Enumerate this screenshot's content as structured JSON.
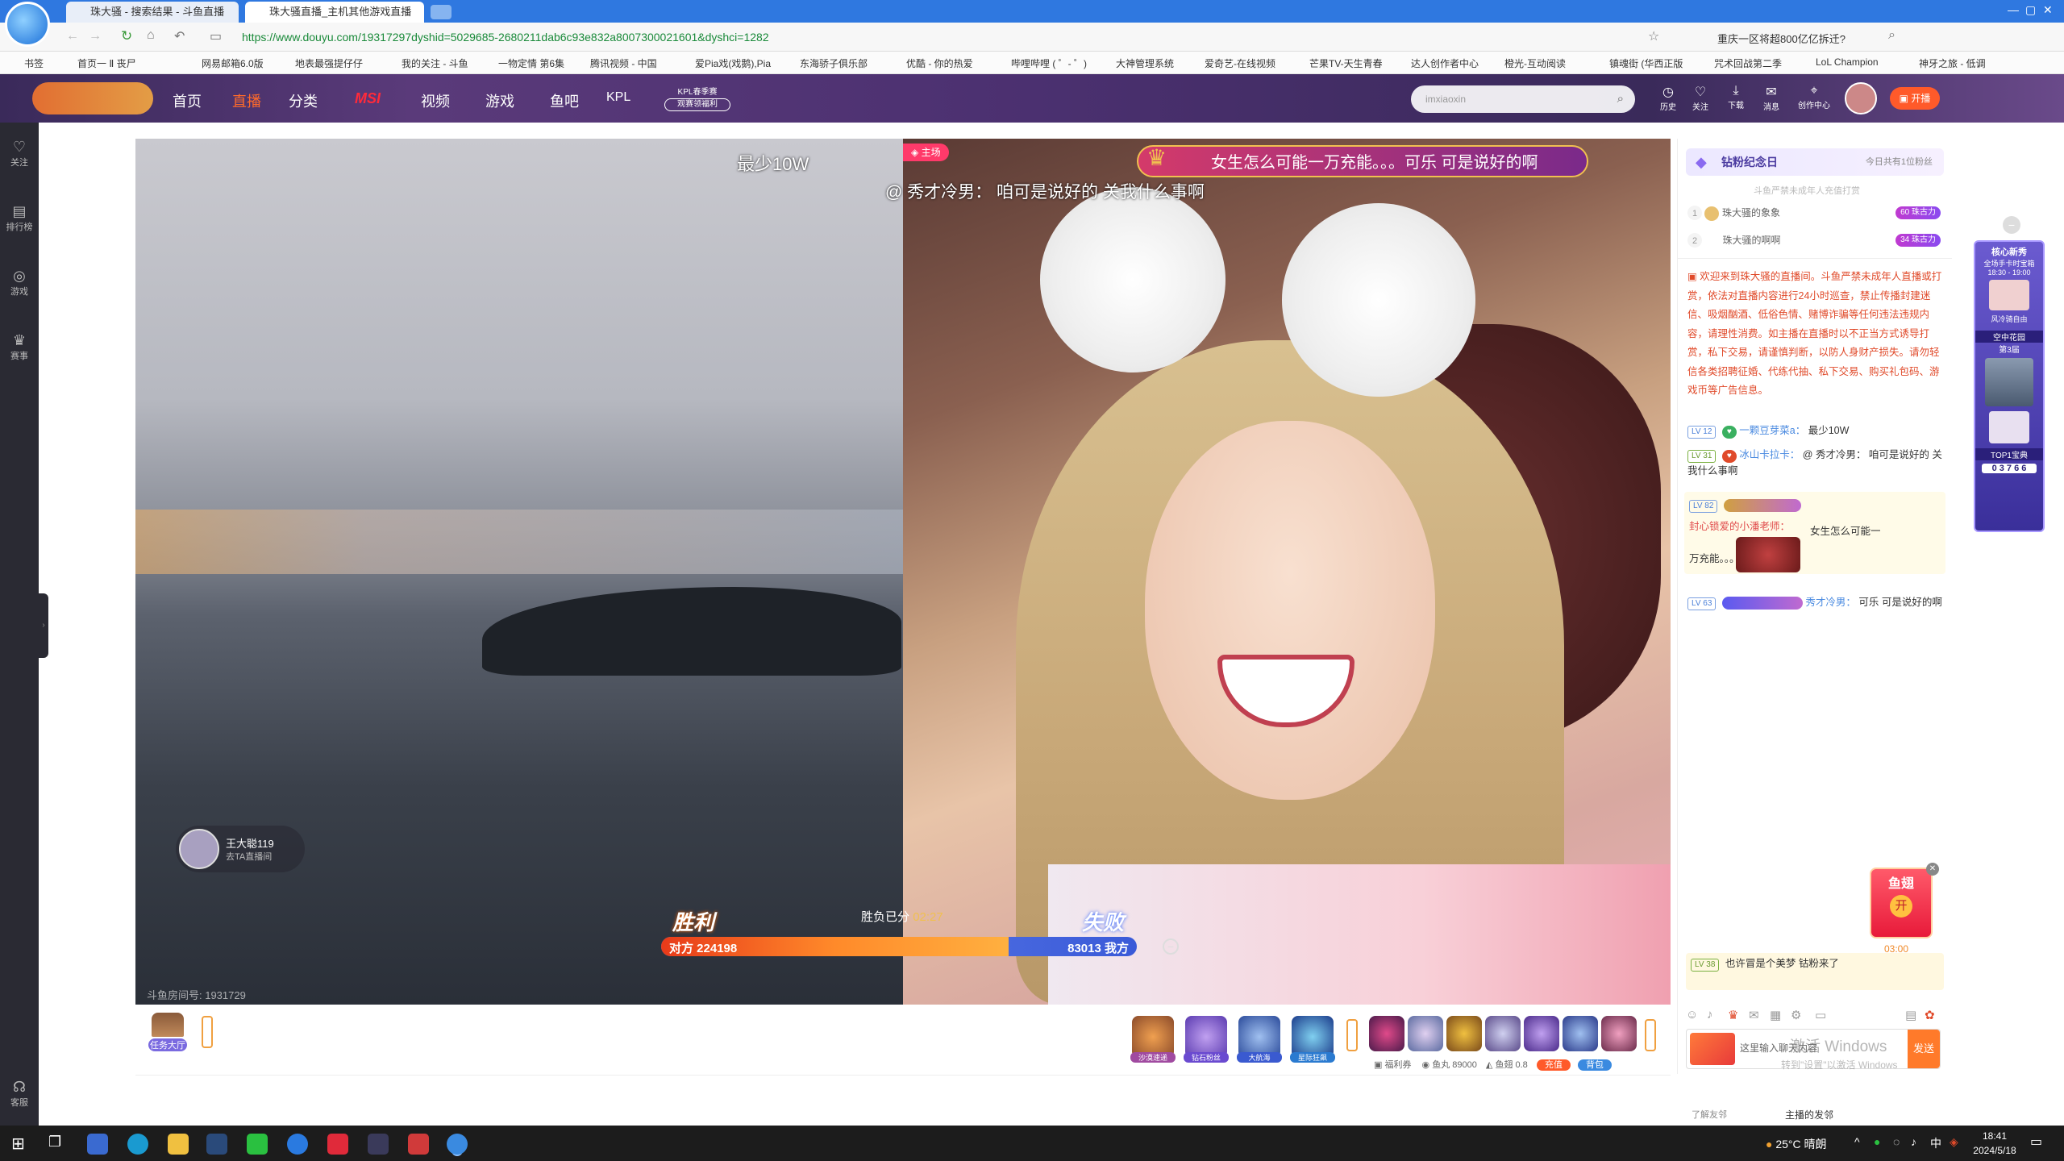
{
  "browser": {
    "tabs": [
      {
        "label": "珠大骚 - 搜索结果 - 斗鱼直播"
      },
      {
        "label": "珠大骚直播_主机其他游戏直播"
      }
    ],
    "url": "https://www.douyu.com/19317297dyshid=5029685-2680211dab6c93e832a8007300021601&dyshci=1282",
    "search_hint": "重庆一区将超800亿亿拆迁?",
    "bookmarks": [
      "书签",
      "首页一 Ⅱ 丧尸",
      "",
      "网易邮箱6.0版",
      "地表最强提仔仔",
      "我的关注 - 斗鱼",
      "一物定情 第6集",
      "腾讯视频 - 中国",
      "爱Pia戏(戏鹅),Pia",
      "东海骄子俱乐部",
      "优酷 - 你的热爱",
      "哔哩哔哩 ( ゜- ゜)",
      "大神管理系统",
      "爱奇艺-在线视频",
      "芒果TV-天生青春",
      "达人创作者中心",
      "橙光-互动阅读",
      "镇魂街 (华西正版",
      "咒术回战第二季",
      "LoL Champion",
      "神牙之旅 - 低调"
    ]
  },
  "site": {
    "nav": [
      "首页",
      "直播",
      "分类",
      "MSI",
      "视频",
      "游戏",
      "鱼吧",
      "KPL"
    ],
    "kpl_banner_line1": "KPL春季赛",
    "kpl_banner_line2": "观赛领福利",
    "search_placeholder": "imxiaoxin",
    "header_icons": [
      "历史",
      "关注",
      "下载",
      "消息",
      "创作中心"
    ],
    "live_button": "开播",
    "sidebar": [
      "关注",
      "排行榜",
      "游戏",
      "赛事",
      "客服"
    ]
  },
  "stream": {
    "overlay_left": "最少10W",
    "host_tag": "主场",
    "gift_banner": "女生怎么可能一万充能。。。可乐 可是说好的啊",
    "barrage": "@ 秀才冷男： 咱可是说好的 关我什么事啊",
    "opponent_name": "王大聪119",
    "opponent_sub": "去TA直播间",
    "win_label": "胜利",
    "lose_label": "失败",
    "pk_time_label": "胜负已分",
    "pk_time": "02:27",
    "left_score": "对方 224198",
    "right_score": "83013 我方",
    "left_share": 0.73,
    "room_id": "斗鱼房间号: 1931729"
  },
  "chat": {
    "fan_day_title": "钻粉纪念日",
    "fan_day_note": "今日共有1位粉丝",
    "notice_line": "斗鱼严禁未成年人充值打赏",
    "rank": [
      {
        "pos": "1",
        "name": "珠大骚的象象",
        "badge": "60 珠古力"
      },
      {
        "pos": "2",
        "name": "珠大骚的啊啊",
        "badge": "34 珠古力"
      }
    ],
    "system_msg": "欢迎来到珠大骚的直播间。斗鱼严禁未成年人直播或打赏，依法对直播内容进行24小时巡查，禁止传播封建迷信、吸烟酗酒、低俗色情、赌博诈骗等任何违法违规内容，请理性消费。如主播在直播时以不正当方式诱导打赏，私下交易，请谨慎判断，以防人身财产损失。请勿轻信各类招聘征婚、代练代抽、私下交易、购买礼包码、游戏币等广告信息。",
    "messages": [
      {
        "lv": "LV 12",
        "user": "一颗豆芽菜a：",
        "text": "最少10W"
      },
      {
        "lv": "LV 31",
        "user": "冰山卡拉卡：",
        "text": "@ 秀才冷男： 咱可是说好的 关我什么事啊"
      },
      {
        "lv": "LV 82",
        "user": "封心锁爱的小潘老师：",
        "text": "女生怎么可能一万充能。。。"
      },
      {
        "lv": "LV 63",
        "user": "秀才冷男：",
        "text": "可乐 可是说好的啊"
      }
    ],
    "bottom_msg": {
      "lv": "LV 38",
      "text": "也许冒是个美梦 钴粉来了"
    },
    "input_placeholder": "这里输入聊天内容",
    "send_label": "发送",
    "fan_label": "鱼翅",
    "fan_open": "开",
    "fan_timer": "03:00",
    "windows_watermark": "激活 Windows",
    "windows_watermark_sub": "转到\"设置\"以激活 Windows",
    "footer_left": "了解友邻",
    "footer_right": "主播的发邻"
  },
  "widget": {
    "title": "核心新秀",
    "line1": "全场手卡时宝箱",
    "line2": "18:30 - 19:00",
    "line3": "风冷骑自由",
    "line4": "空中花园",
    "line5": "第3届",
    "line6": "TOP1宝典",
    "counter": "0 3 7 6 6"
  },
  "toolbar": {
    "task_label": "任务大厅",
    "gift_names": [
      "沙漠速递",
      "钻石粉丝",
      "大航海",
      "星际狂飙"
    ],
    "stats": [
      "福利券",
      "鱼丸 89000",
      "鱼翅 0.8"
    ],
    "recharge": "充值",
    "backpack": "背包"
  },
  "taskbar": {
    "weather": "25°C 晴朗",
    "ime": "中",
    "time": "18:41",
    "date": "2024/5/18"
  }
}
